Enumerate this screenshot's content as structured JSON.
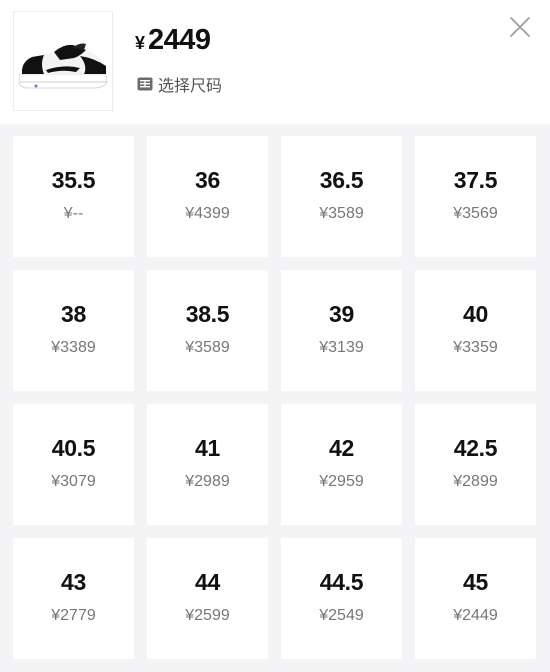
{
  "header": {
    "currency_symbol": "¥",
    "price": "2449",
    "size_prompt": "选择尺码",
    "product_image_icon": "sneaker-thumbnail",
    "prompt_icon": "size-chart-icon",
    "close_icon": "close-icon"
  },
  "sizes": [
    {
      "size": "35.5",
      "price": "¥--"
    },
    {
      "size": "36",
      "price": "¥4399"
    },
    {
      "size": "36.5",
      "price": "¥3589"
    },
    {
      "size": "37.5",
      "price": "¥3569"
    },
    {
      "size": "38",
      "price": "¥3389"
    },
    {
      "size": "38.5",
      "price": "¥3589"
    },
    {
      "size": "39",
      "price": "¥3139"
    },
    {
      "size": "40",
      "price": "¥3359"
    },
    {
      "size": "40.5",
      "price": "¥3079"
    },
    {
      "size": "41",
      "price": "¥2989"
    },
    {
      "size": "42",
      "price": "¥2959"
    },
    {
      "size": "42.5",
      "price": "¥2899"
    },
    {
      "size": "43",
      "price": "¥2779"
    },
    {
      "size": "44",
      "price": "¥2599"
    },
    {
      "size": "44.5",
      "price": "¥2549"
    },
    {
      "size": "45",
      "price": "¥2449"
    }
  ],
  "colors": {
    "background": "#f4f4f6",
    "cell": "#ffffff",
    "text": "#111111",
    "muted": "#777777"
  }
}
